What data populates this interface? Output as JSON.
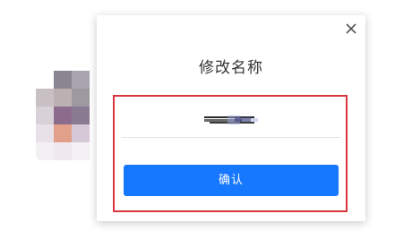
{
  "dialog": {
    "title": "修改名称",
    "confirm_label": "确认",
    "close_icon": "close-icon",
    "name_field_value": ""
  },
  "colors": {
    "primary": "#1677ff",
    "highlight_border": "#d9363e"
  },
  "avatar_mosaic": [
    [
      "#ffffff",
      "#8a8590",
      "#a9a4ad",
      "#ffffff"
    ],
    [
      "#c9c0c4",
      "#bcb0b0",
      "#9c9aa0",
      "#ffffff"
    ],
    [
      "#d8d2d8",
      "#8c6c8c",
      "#8a7a92",
      "#ffffff"
    ],
    [
      "#e8e2e8",
      "#e2a08a",
      "#d7c8d8",
      "#ffffff"
    ],
    [
      "#f2f0f2",
      "#efe8ec",
      "#f5f0f4",
      "#ffffff"
    ]
  ]
}
